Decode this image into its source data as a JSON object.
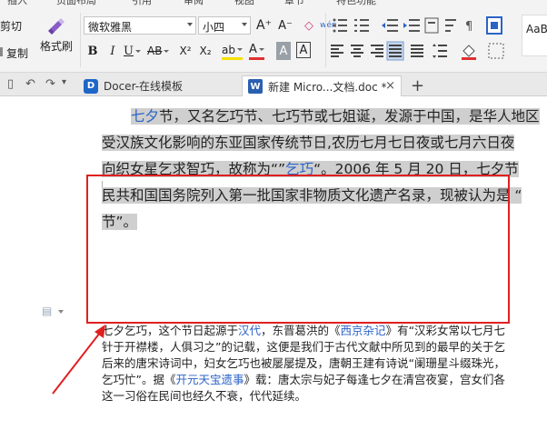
{
  "ribbon": {
    "menu_partial": [
      "插入",
      "页面布局",
      "引用",
      "审阅",
      "视图",
      "章节",
      "特色功能"
    ],
    "clipboard": {
      "cut_label": "剪切",
      "copy_label": "复制",
      "format_painter_label": "格式刷"
    },
    "font": {
      "family": "微软雅黑",
      "size": "小四"
    },
    "tools": {
      "grow_font": "A⁺",
      "shrink_font": "A⁻",
      "clear_format": "◇",
      "wen": "wén",
      "bold": "B",
      "italic": "I",
      "underline": "U",
      "strikethrough": "AB",
      "superscript": "X²",
      "subscript": "X₂",
      "highlight": "ab",
      "font_color": "A",
      "char_shading": "A",
      "char_border": "A"
    },
    "style_preview": "AaB"
  },
  "tabs": {
    "docer": "Docer-在线模板",
    "active": "新建 Micro...文档.doc *",
    "close_symbol": "×",
    "new_symbol": "+"
  },
  "document": {
    "para1": {
      "line1_a": "七夕",
      "line1_b": "节，又名乞巧节、七巧节或七姐诞，发源于中国，是华人地区",
      "line2": "受汉族文化影响的东亚国家传统节日,农历七月七日夜或七月六日夜",
      "line3_a": "向织女星乞求智巧，故称为“”",
      "line3_b": "乞巧",
      "line3_c": "“。2006 年 5 月 20 日，七夕节",
      "line4": "民共和国国务院列入第一批国家非物质文化遗产名录，现被认为是 “",
      "line5": "节”。"
    },
    "para2": {
      "l1_a": "七夕乞巧，这个节日起源于",
      "l1_b": "汉代",
      "l1_c": "，东晋葛洪的《",
      "l1_d": "西京杂记",
      "l1_e": "》有“汉彩女常以七月七",
      "l2": "针于开襟楼，人俱习之”的记载，这便是我们于古代文献中所见到的最早的关于乞",
      "l3": "后来的唐宋诗词中，妇女乞巧也被屡屡提及，唐朝王建有诗说“阑珊星斗缀珠光，",
      "l4_a": "乞巧忙”。据《",
      "l4_b": "开元天宝遗事",
      "l4_c": "》载：唐太宗与妃子每逢七夕在清宫夜宴，宫女们各",
      "l5": "这一习俗在民间也经久不衰，代代延续。"
    }
  },
  "colors": {
    "annotation": "#e02020",
    "link": "#2b63c6",
    "selection": "#cfcfcf"
  }
}
